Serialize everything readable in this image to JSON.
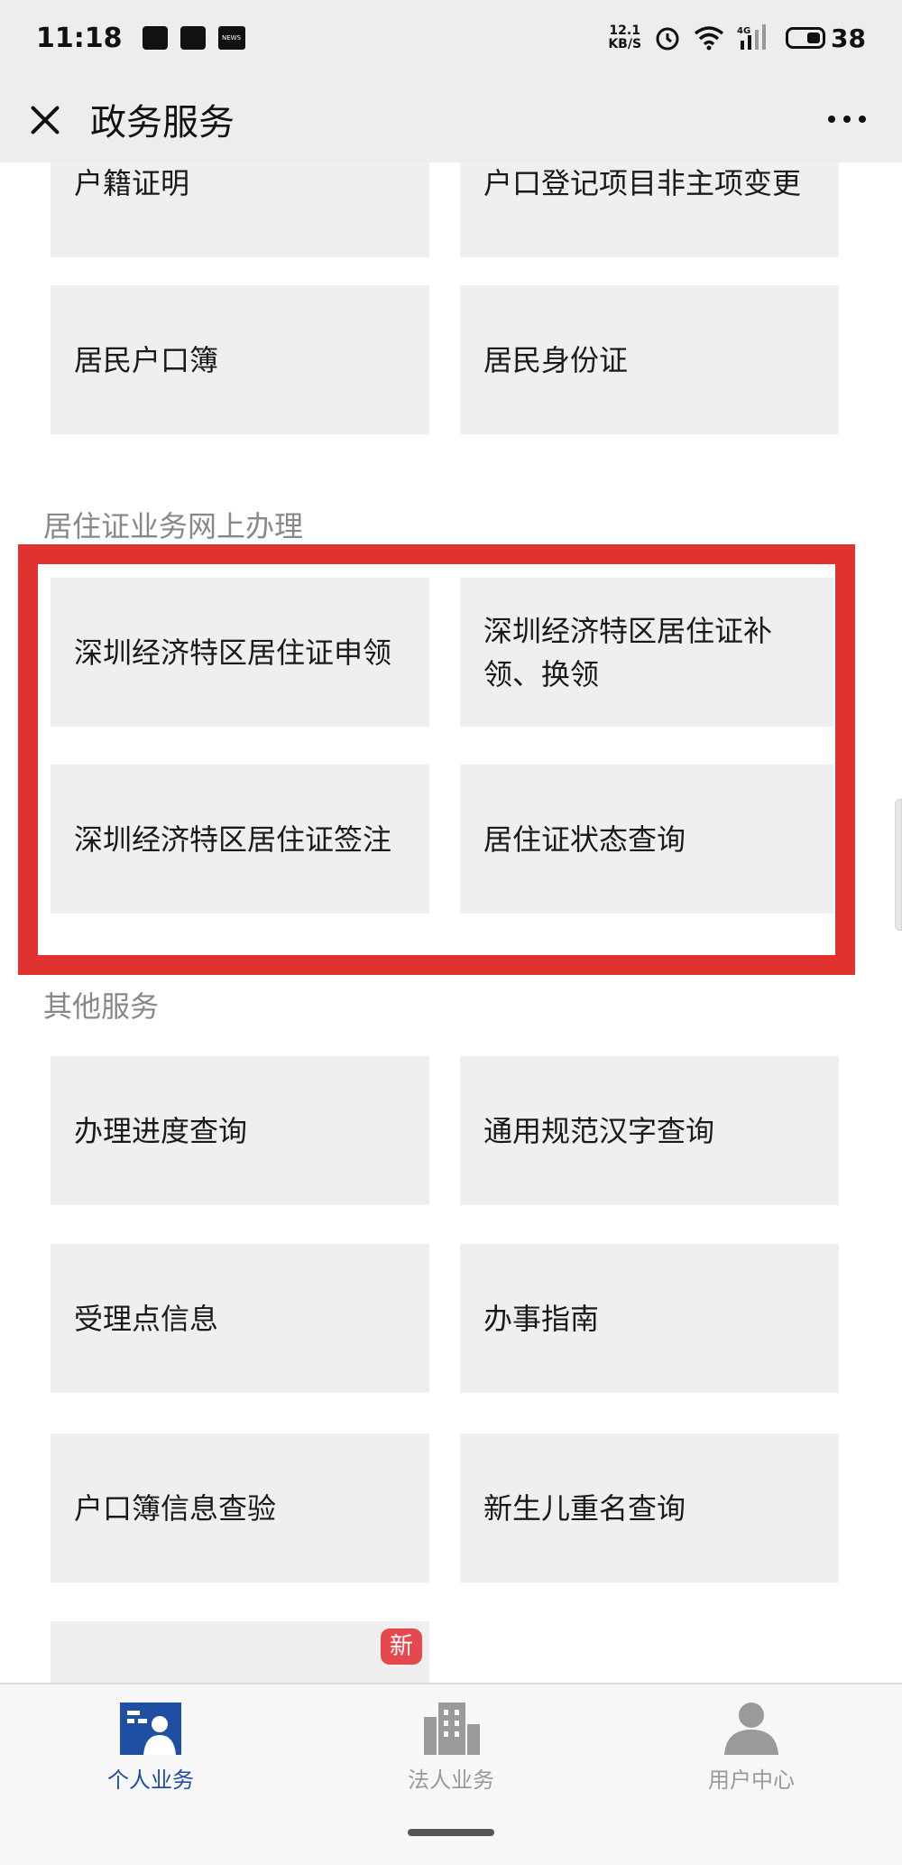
{
  "status_bar": {
    "time": "11:18",
    "speed_value": "12.1",
    "speed_unit": "KB/S",
    "network": "4G",
    "battery": "38",
    "icons": [
      "notification-icon",
      "message-icon",
      "news-icon",
      "alarm-icon",
      "wifi-icon",
      "signal-icon",
      "battery-icon"
    ]
  },
  "nav": {
    "title": "政务服务"
  },
  "sections": {
    "top_tiles": [
      {
        "label": "户籍证明"
      },
      {
        "label": "户口登记项目非主项变更"
      },
      {
        "label": "居民户口簿"
      },
      {
        "label": "居民身份证"
      }
    ],
    "residence": {
      "title": "居住证业务网上办理",
      "tiles": [
        {
          "label": "深圳经济特区居住证申领"
        },
        {
          "label": "深圳经济特区居住证补领、换领"
        },
        {
          "label": "深圳经济特区居住证签注"
        },
        {
          "label": "居住证状态查询"
        }
      ]
    },
    "other": {
      "title": "其他服务",
      "tiles": [
        {
          "label": "办理进度查询"
        },
        {
          "label": "通用规范汉字查询"
        },
        {
          "label": "受理点信息"
        },
        {
          "label": "办事指南"
        },
        {
          "label": "户口簿信息查验"
        },
        {
          "label": "新生儿重名查询"
        },
        {
          "label": "",
          "badge": "新"
        }
      ]
    }
  },
  "tabs": [
    {
      "label": "个人业务",
      "active": true
    },
    {
      "label": "法人业务",
      "active": false
    },
    {
      "label": "用户中心",
      "active": false
    }
  ],
  "colors": {
    "accent": "#1f4fa3",
    "highlight": "#e0332f",
    "tile_bg": "#efefef",
    "badge": "#e5484d"
  }
}
